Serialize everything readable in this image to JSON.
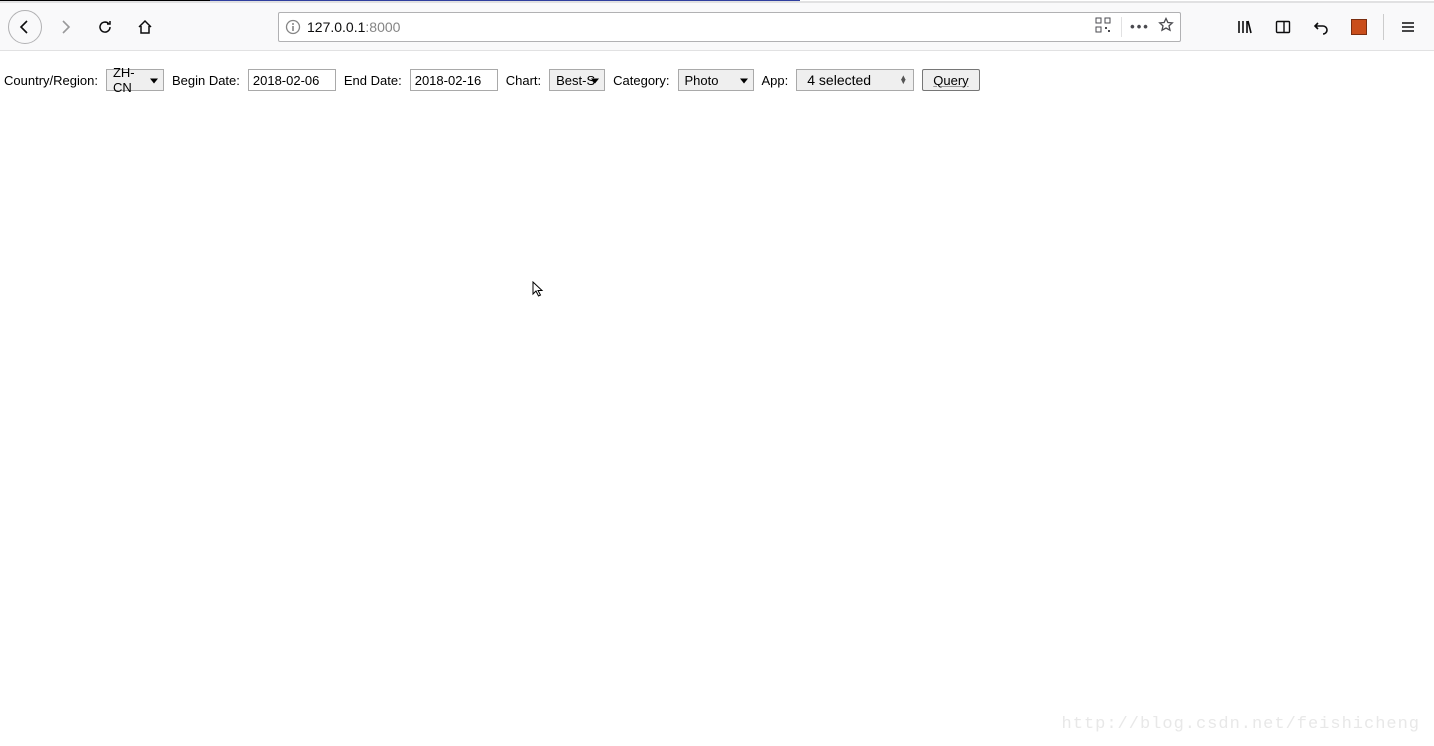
{
  "browser": {
    "url_host": "127.0.0.1",
    "url_port": ":8000"
  },
  "filters": {
    "country_region_label": "Country/Region:",
    "country_region_value": "ZH-CN",
    "begin_date_label": "Begin Date:",
    "begin_date_value": "2018-02-06",
    "end_date_label": "End Date:",
    "end_date_value": "2018-02-16",
    "chart_label": "Chart:",
    "chart_value": "Best-S",
    "category_label": "Category:",
    "category_value": "Photo",
    "app_label": "App:",
    "app_value": "4 selected",
    "query_button": "Query"
  },
  "watermark": "http://blog.csdn.net/feishicheng"
}
